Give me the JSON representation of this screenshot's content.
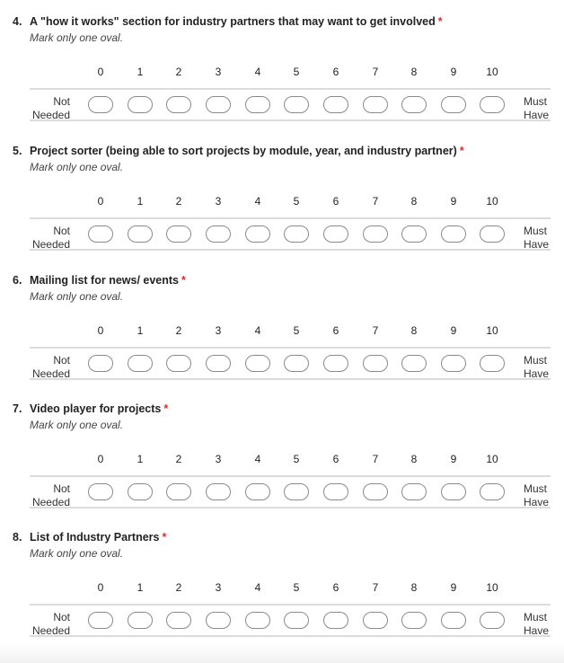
{
  "scale": {
    "numbers": [
      "0",
      "1",
      "2",
      "3",
      "4",
      "5",
      "6",
      "7",
      "8",
      "9",
      "10"
    ],
    "low_label_line1": "Not",
    "low_label_line2": "Needed",
    "high_label_line1": "Must",
    "high_label_line2": "Have"
  },
  "questions": [
    {
      "number": "4.",
      "title": "A \"how it works\" section for industry partners that may want to get involved",
      "required_mark": "*",
      "hint": "Mark only one oval."
    },
    {
      "number": "5.",
      "title": "Project sorter (being able to sort projects by module, year, and industry partner)",
      "required_mark": "*",
      "hint": "Mark only one oval."
    },
    {
      "number": "6.",
      "title": "Mailing list for news/ events",
      "required_mark": "*",
      "hint": "Mark only one oval."
    },
    {
      "number": "7.",
      "title": "Video player for projects",
      "required_mark": "*",
      "hint": "Mark only one oval."
    },
    {
      "number": "8.",
      "title": "List of Industry Partners",
      "required_mark": "*",
      "hint": "Mark only one oval."
    }
  ]
}
